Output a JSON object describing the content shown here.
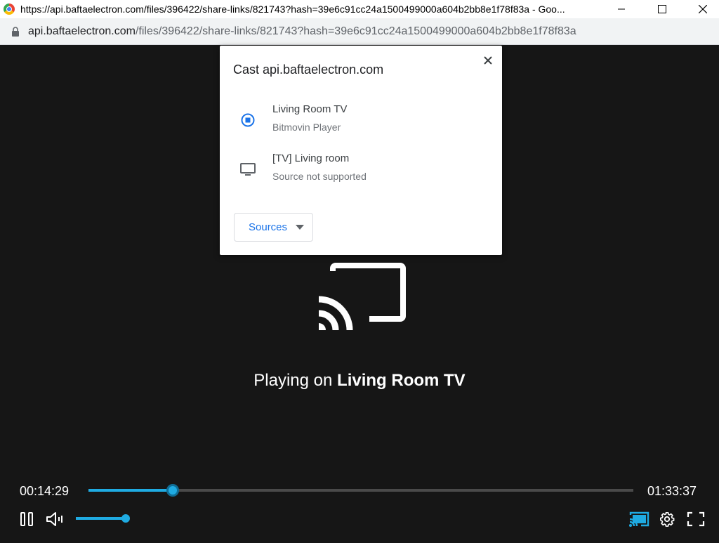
{
  "window": {
    "title": "https://api.baftaelectron.com/files/396422/share-links/821743?hash=39e6c91cc24a1500499000a604b2bb8e1f78f83a - Goo...",
    "icon": "chrome-icon",
    "controls": [
      "minimize-icon",
      "maximize-icon",
      "close-icon"
    ]
  },
  "address_bar": {
    "host": "api.baftaelectron.com",
    "path": "/files/396422/share-links/821743?hash=39e6c91cc24a1500499000a604b2bb8e1f78f83a"
  },
  "cast_dialog": {
    "title": "Cast api.baftaelectron.com",
    "sinks": [
      {
        "name": "Living Room TV",
        "status": "Bitmovin Player",
        "icon": "casting-active-icon",
        "active": true
      },
      {
        "name": "[TV] Living room",
        "status": "Source not supported",
        "icon": "tv-icon",
        "active": false
      }
    ],
    "sources_label": "Sources"
  },
  "player": {
    "playing_prefix": "Playing on",
    "playing_device": "Living Room TV",
    "current_time": "00:14:29",
    "total_time": "01:33:37",
    "progress_fraction": 0.154,
    "volume_fraction": 1.0,
    "accent_color": "#1fabe2"
  }
}
